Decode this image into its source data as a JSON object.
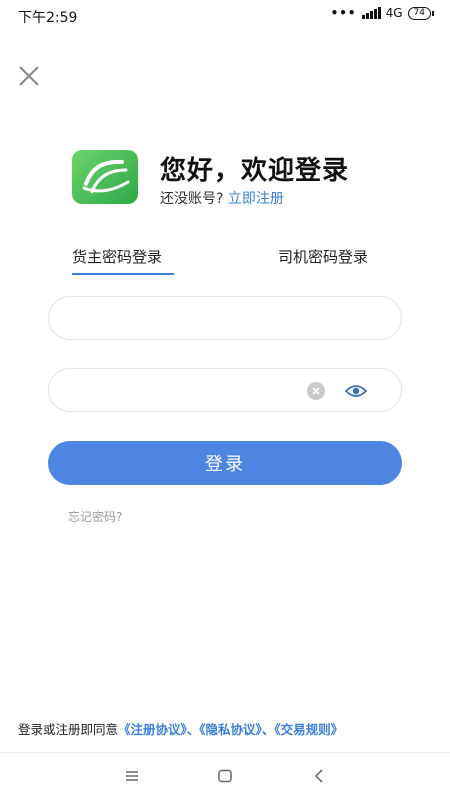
{
  "status_bar": {
    "time": "下午2:59",
    "dots": "•••",
    "network": "4G",
    "battery": "74"
  },
  "header": {
    "title": "您好，欢迎登录",
    "register_prompt": "还没账号?",
    "register_link": "立即注册"
  },
  "tabs": [
    {
      "label": "货主密码登录",
      "active": true
    },
    {
      "label": "司机密码登录",
      "active": false
    }
  ],
  "form": {
    "account_value": "",
    "account_placeholder": "",
    "password_value": "",
    "password_placeholder": "",
    "login_label": "登录",
    "forgot_label": "忘记密码?"
  },
  "agreement": {
    "prefix": "登录或注册即同意",
    "links": [
      "《注册协议》",
      "《隐私协议》",
      "《交易规则》"
    ],
    "separator": "、"
  },
  "icons": {
    "close": "close-icon",
    "clear": "clear-icon",
    "eye": "eye-icon",
    "nav_menu": "menu-icon",
    "nav_home": "home-icon",
    "nav_back": "back-icon"
  },
  "colors": {
    "accent": "#4d86e0",
    "link": "#3b7fd8",
    "logo_green": "#2fa84a"
  }
}
